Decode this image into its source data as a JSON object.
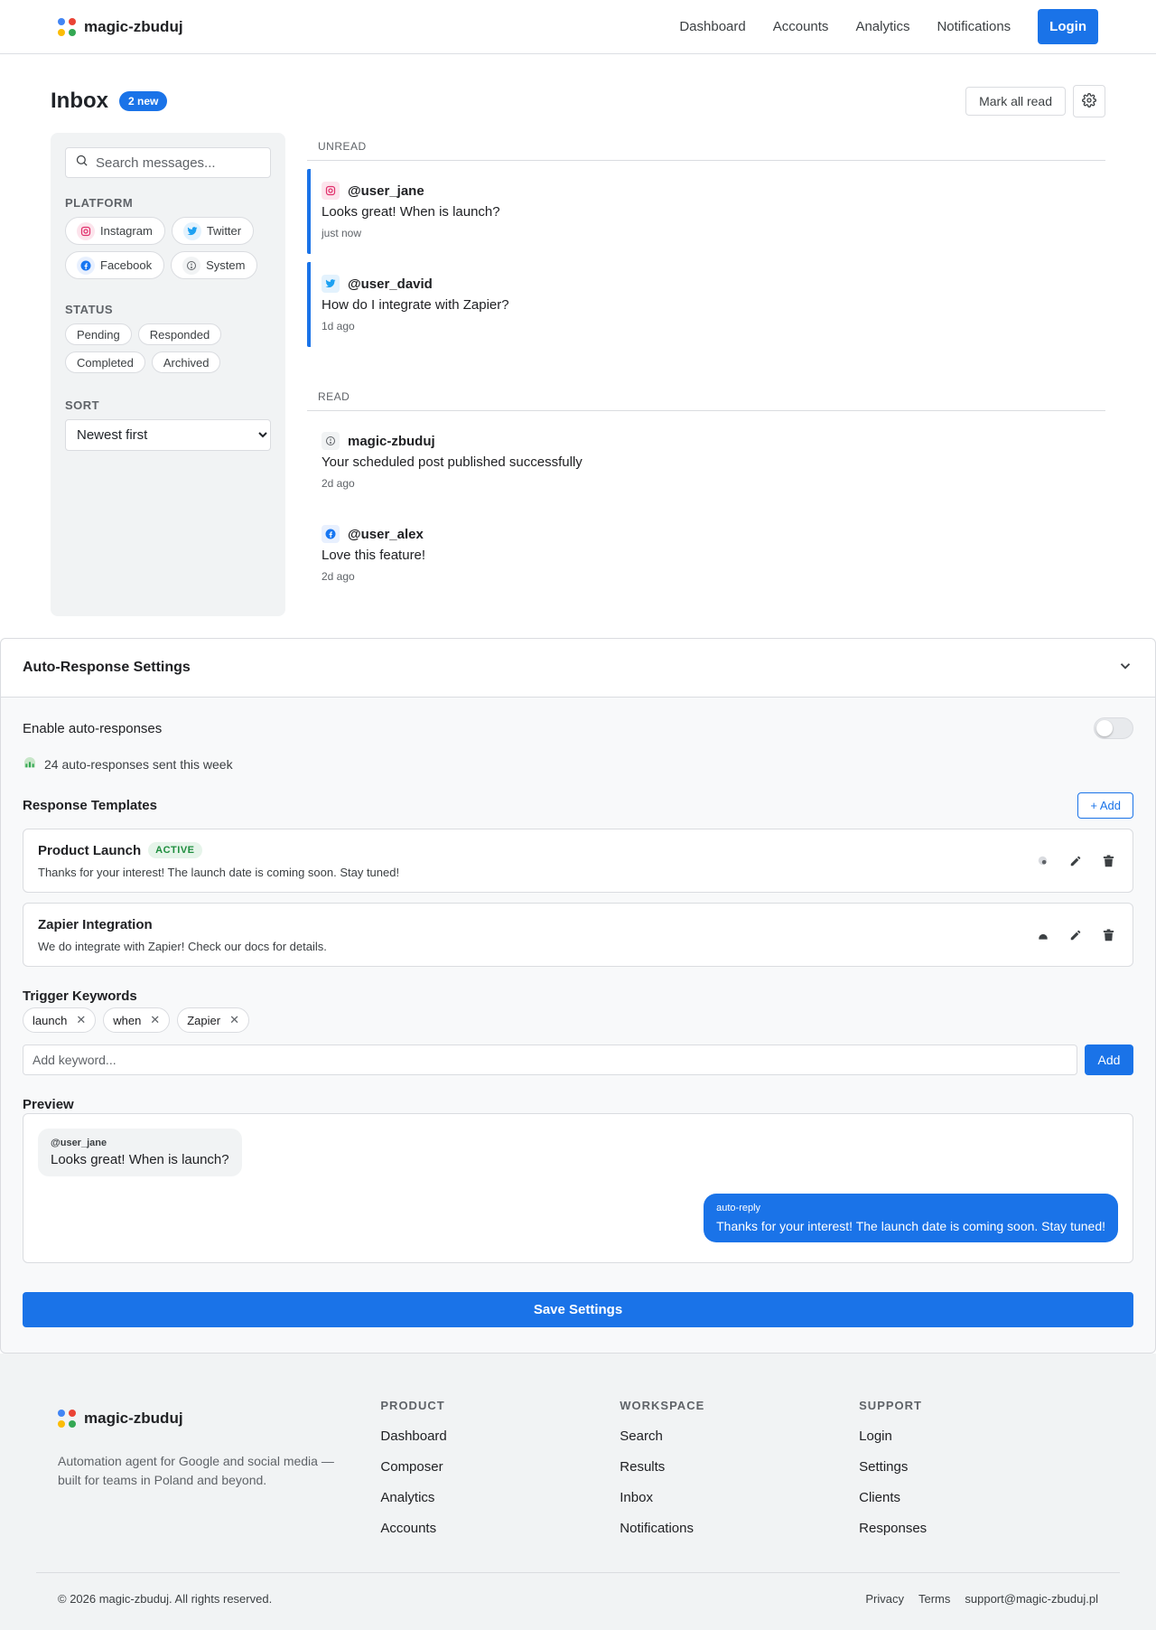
{
  "header": {
    "brand": "magic-zbuduj",
    "nav": [
      "Dashboard",
      "Accounts",
      "Analytics",
      "Notifications"
    ],
    "login_label": "Login"
  },
  "inbox": {
    "title": "Inbox",
    "new_badge": "2 new",
    "mark_all_read": "Mark all read",
    "search_placeholder": "Search messages...",
    "platform_label": "PLATFORM",
    "platforms": [
      {
        "label": "Instagram",
        "icon": "instagram-icon"
      },
      {
        "label": "Twitter",
        "icon": "twitter-icon"
      },
      {
        "label": "Facebook",
        "icon": "facebook-icon"
      },
      {
        "label": "System",
        "icon": "system-icon"
      }
    ],
    "status_label": "STATUS",
    "statuses": [
      "Pending",
      "Responded",
      "Completed",
      "Archived"
    ],
    "sort_label": "SORT",
    "sort_value": "Newest first",
    "unread_label": "UNREAD",
    "read_label": "READ",
    "unread": [
      {
        "user": "@user_jane",
        "text": "Looks great! When is launch?",
        "time": "just now",
        "icon": "instagram-icon"
      },
      {
        "user": "@user_david",
        "text": "How do I integrate with Zapier?",
        "time": "1d ago",
        "icon": "twitter-icon"
      }
    ],
    "read": [
      {
        "user": "magic-zbuduj",
        "text": "Your scheduled post published successfully",
        "time": "2d ago",
        "icon": "system-icon"
      },
      {
        "user": "@user_alex",
        "text": "Love this feature!",
        "time": "2d ago",
        "icon": "facebook-icon"
      }
    ]
  },
  "auto": {
    "title": "Auto-Response Settings",
    "enable_label": "Enable auto-responses",
    "enabled": false,
    "stat": "24 auto-responses sent this week",
    "templates_title": "Response Templates",
    "add_label": "+ Add",
    "templates": [
      {
        "name": "Product Launch",
        "badge": "ACTIVE",
        "text": "Thanks for your interest! The launch date is coming soon. Stay tuned!"
      },
      {
        "name": "Zapier Integration",
        "badge": "",
        "text": "We do integrate with Zapier! Check our docs for details."
      }
    ],
    "keywords_title": "Trigger Keywords",
    "keywords": [
      "launch",
      "when",
      "Zapier"
    ],
    "keyword_placeholder": "Add keyword...",
    "keyword_add": "Add",
    "preview_title": "Preview",
    "preview_in_user": "@user_jane",
    "preview_in_text": "Looks great! When is launch?",
    "preview_out_meta": "auto-reply",
    "preview_out_text": "Thanks for your interest! The launch date is coming soon. Stay tuned!",
    "save_label": "Save Settings"
  },
  "footer": {
    "brand": "magic-zbuduj",
    "desc": "Automation agent for Google and social media — built for teams in Poland and beyond.",
    "columns": [
      {
        "title": "PRODUCT",
        "items": [
          "Dashboard",
          "Composer",
          "Analytics",
          "Accounts"
        ]
      },
      {
        "title": "WORKSPACE",
        "items": [
          "Search",
          "Results",
          "Inbox",
          "Notifications"
        ]
      },
      {
        "title": "SUPPORT",
        "items": [
          "Login",
          "Settings",
          "Clients",
          "Responses"
        ]
      }
    ],
    "copyright": "© 2026 magic-zbuduj. All rights reserved.",
    "links": [
      "Privacy",
      "Terms",
      "support@magic-zbuduj.pl"
    ]
  },
  "colors": {
    "accent": "#1a73e8",
    "instagram": "#e1306c",
    "twitter": "#1da1f2",
    "facebook": "#1877f2",
    "active_green": "#1e8e3e"
  }
}
